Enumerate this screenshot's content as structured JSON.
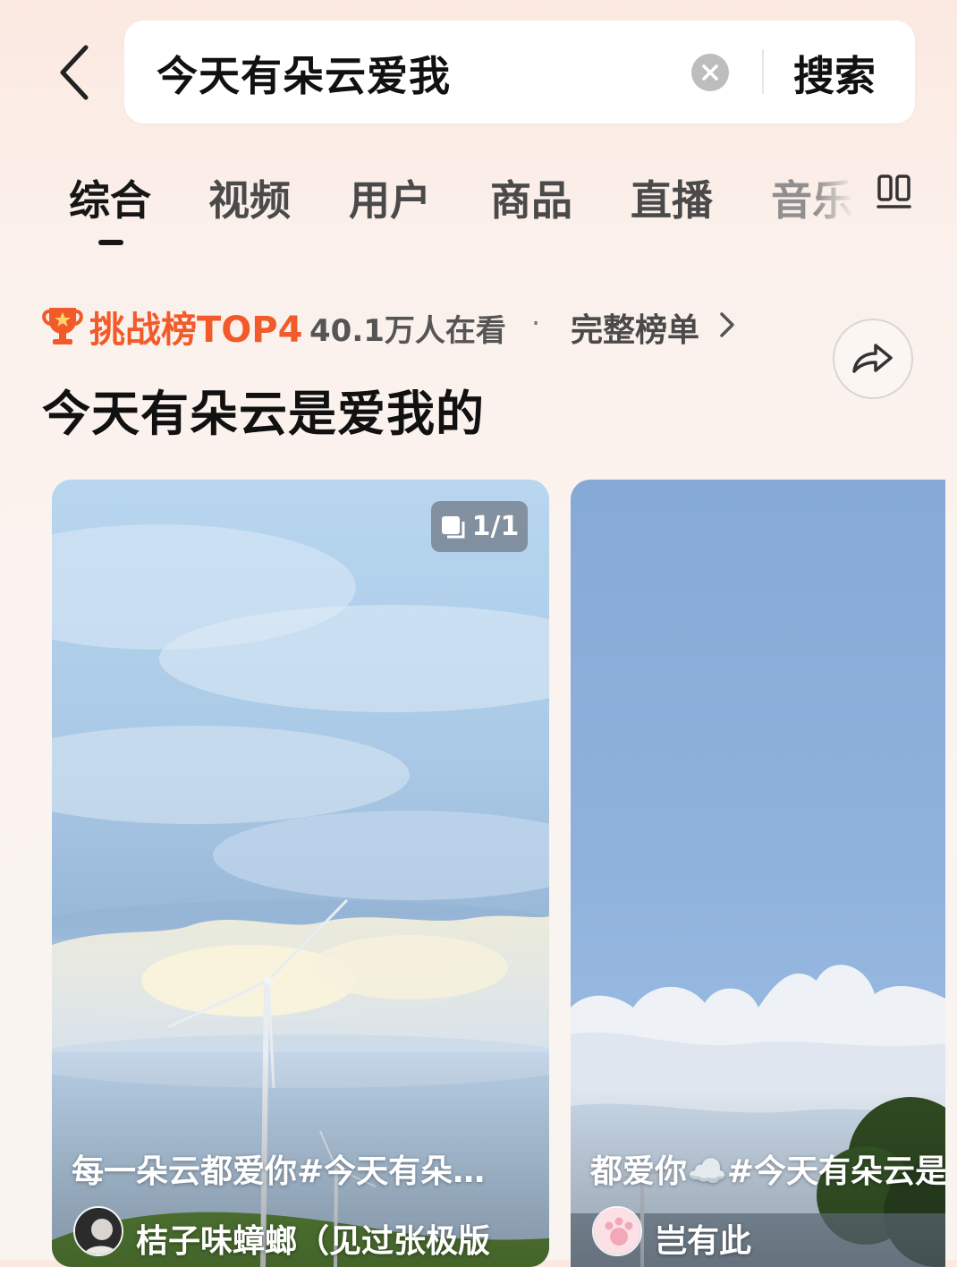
{
  "search": {
    "query": "今天有朵云爱我",
    "button_label": "搜索"
  },
  "tabs": [
    {
      "label": "综合",
      "active": true
    },
    {
      "label": "视频"
    },
    {
      "label": "用户"
    },
    {
      "label": "商品"
    },
    {
      "label": "直播"
    },
    {
      "label": "音乐"
    }
  ],
  "ranking": {
    "label": "挑战榜TOP4",
    "watching": "40.1万人在看",
    "separator": "·",
    "full_list": "完整榜单",
    "topic_title": "今天有朵云是爱我的"
  },
  "cards": [
    {
      "badge": "1/1",
      "caption": "每一朵云都爱你#今天有朵…",
      "author": "桔子味蟑螂（见过张极版"
    },
    {
      "caption": "都爱你☁️#今天有朵云是",
      "author": "岂有此"
    }
  ],
  "icons": {
    "back": "chevron-left-icon",
    "clear": "clear-circle-icon",
    "filter": "filter-icon",
    "trophy": "trophy-icon",
    "chevron": "chevron-right-icon",
    "share": "share-arrow-icon",
    "badge": "image-stack-icon"
  },
  "colors": {
    "rank_accent": "#f25a2a",
    "text_primary": "#161616",
    "page_background": "#fbf1ec"
  }
}
